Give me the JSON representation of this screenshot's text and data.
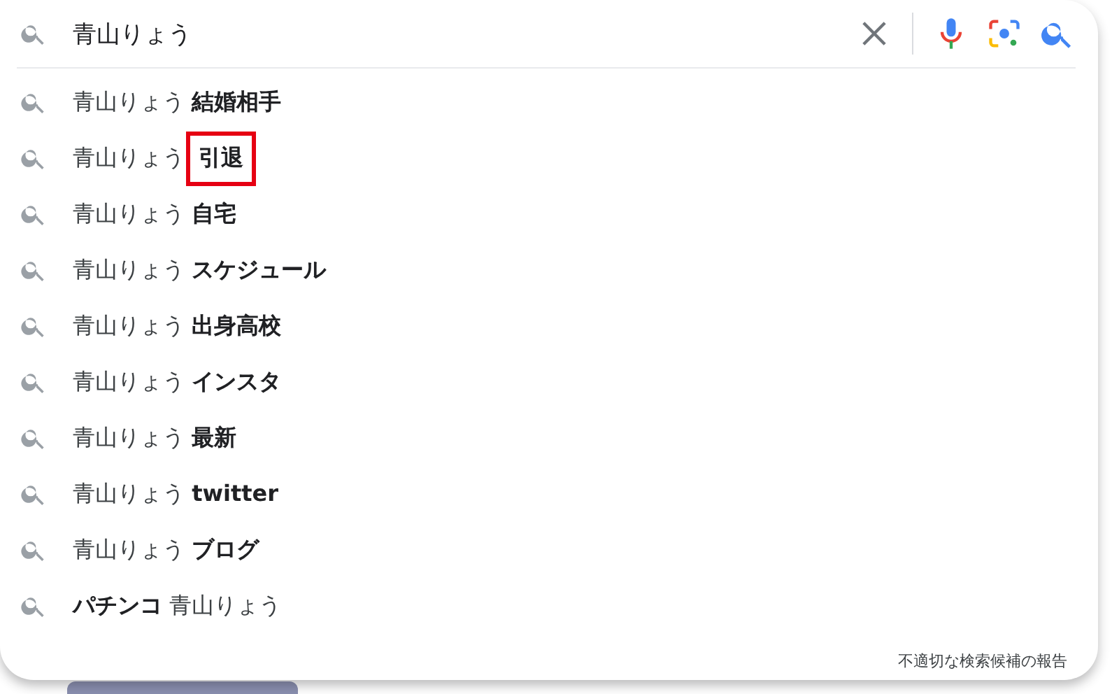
{
  "search": {
    "value": "青山りょう"
  },
  "suggestions": [
    {
      "text": "青山りょう **結婚相手**",
      "highlighted": false
    },
    {
      "text": "青山りょう **引退**",
      "highlighted": true
    },
    {
      "text": "青山りょう **自宅**",
      "highlighted": false
    },
    {
      "text": "青山りょう **スケジュール**",
      "highlighted": false
    },
    {
      "text": "青山りょう **出身高校**",
      "highlighted": false
    },
    {
      "text": "青山りょう **インスタ**",
      "highlighted": false
    },
    {
      "text": "青山りょう **最新**",
      "highlighted": false
    },
    {
      "text": "青山りょう **twitter**",
      "highlighted": false
    },
    {
      "text": "青山りょう **ブログ**",
      "highlighted": false
    },
    {
      "text": "**パチンコ** 青山りょう",
      "highlighted": false
    }
  ],
  "report_link": "不適切な検索候補の報告"
}
